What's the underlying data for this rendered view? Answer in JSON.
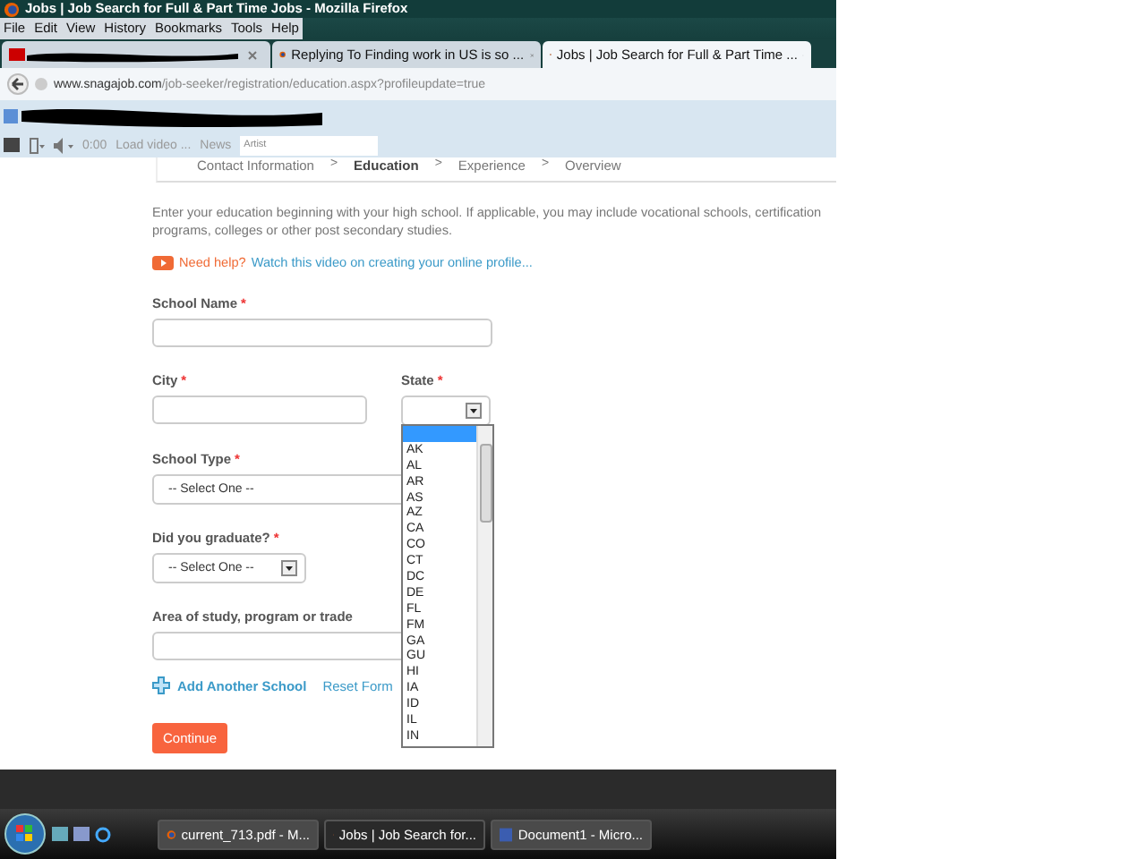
{
  "window": {
    "title": "Jobs | Job Search for Full & Part Time Jobs - Mozilla Firefox"
  },
  "menu": [
    "File",
    "Edit",
    "View",
    "History",
    "Bookmarks",
    "Tools",
    "Help"
  ],
  "tabs": [
    {
      "redacted": true,
      "selected": false
    },
    {
      "title": "Replying To Finding work in US is so ...",
      "redacted": false,
      "selected": false
    },
    {
      "title": "Jobs | Job Search for Full & Part Time ...",
      "redacted": false,
      "selected": true
    }
  ],
  "address": {
    "domain": "www.snagajob.com",
    "path": "/job-seeker/registration/education.aspx?profileupdate=true"
  },
  "bookmarks_bar": {
    "redacted": true
  },
  "media_toolbar": {
    "time": "0:00",
    "load_video": "Load video ...",
    "news": "News",
    "search_placeholder": "Artist"
  },
  "breadcrumb": [
    {
      "label": "Contact Information",
      "selected": false
    },
    {
      "label": "Education",
      "selected": true
    },
    {
      "label": "Experience",
      "selected": false
    },
    {
      "label": "Overview",
      "selected": false
    }
  ],
  "breadcrumb_separator": ">",
  "intro": "Enter your education beginning with your high school. If applicable, you may include vocational schools, certification programs, colleges or other post secondary studies.",
  "help": {
    "label": "Need help?",
    "link": "Watch this video on creating your online profile..."
  },
  "fields": [
    {
      "kind": "text",
      "label": "School Name",
      "required": true
    },
    {
      "kind": "text",
      "label": "City",
      "required": true
    },
    {
      "kind": "state",
      "label": "State",
      "required": true
    },
    {
      "kind": "wide-select",
      "label": "School Type",
      "required": true,
      "value": "-- Select One --"
    },
    {
      "kind": "select",
      "label": "Did you graduate?",
      "required": true,
      "value": "-- Select One --"
    },
    {
      "kind": "text",
      "label": "Area of study, program or trade",
      "required": false
    }
  ],
  "required_mark": "*",
  "state_options": [
    {
      "selected": true
    },
    {
      "label": "AK",
      "selected": false
    },
    {
      "label": "AL",
      "selected": false
    },
    {
      "label": "AR",
      "selected": false
    },
    {
      "label": "AS",
      "selected": false
    },
    {
      "label": "AZ",
      "selected": false
    },
    {
      "label": "CA",
      "selected": false
    },
    {
      "label": "CO",
      "selected": false
    },
    {
      "label": "CT",
      "selected": false
    },
    {
      "label": "DC",
      "selected": false
    },
    {
      "label": "DE",
      "selected": false
    },
    {
      "label": "FL",
      "selected": false
    },
    {
      "label": "FM",
      "selected": false
    },
    {
      "label": "GA",
      "selected": false
    },
    {
      "label": "GU",
      "selected": false
    },
    {
      "label": "HI",
      "selected": false
    },
    {
      "label": "IA",
      "selected": false
    },
    {
      "label": "ID",
      "selected": false
    },
    {
      "label": "IL",
      "selected": false
    },
    {
      "label": "IN",
      "selected": false
    }
  ],
  "actions": {
    "add_school": "Add Another School",
    "reset": "Reset Form",
    "continue": "Continue"
  },
  "taskbar": [
    {
      "label": "current_713.pdf - M...",
      "selected": false,
      "kind": "firefox"
    },
    {
      "label": "Jobs | Job Search for...",
      "selected": true,
      "kind": "firefox"
    },
    {
      "label": "Document1 - Micro...",
      "selected": false,
      "kind": "word"
    }
  ]
}
